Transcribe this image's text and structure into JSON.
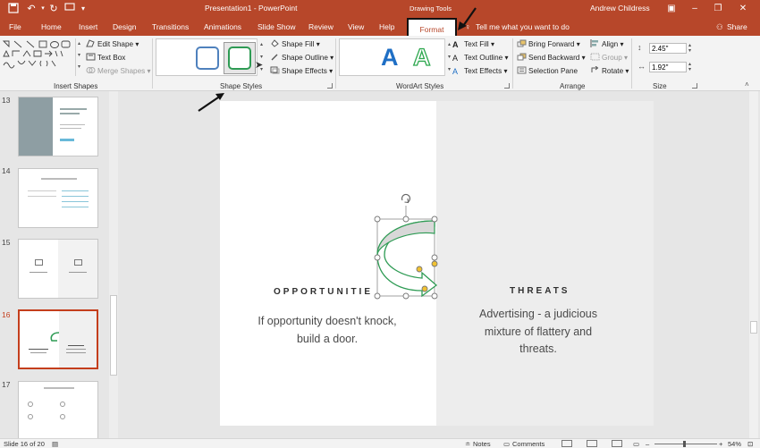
{
  "window": {
    "title": "Presentation1 - PowerPoint",
    "contextual_group": "Drawing Tools",
    "user": "Andrew Childress",
    "share_label": "Share"
  },
  "tabs": [
    "File",
    "Home",
    "Insert",
    "Design",
    "Transitions",
    "Animations",
    "Slide Show",
    "Review",
    "View",
    "Help"
  ],
  "active_tab": "Format",
  "tell_me": "Tell me what you want to do",
  "ribbon": {
    "insert_shapes": {
      "label": "Insert Shapes",
      "edit_shape": "Edit Shape",
      "text_box": "Text Box",
      "merge_shapes": "Merge Shapes"
    },
    "shape_styles": {
      "label": "Shape Styles",
      "fill": "Shape Fill",
      "outline": "Shape Outline",
      "effects": "Shape Effects"
    },
    "wordart_styles": {
      "label": "WordArt Styles",
      "preview_letter_a": "A",
      "preview_letter_b": "A",
      "text_fill": "Text Fill",
      "text_outline": "Text Outline",
      "text_effects": "Text Effects"
    },
    "arrange": {
      "label": "Arrange",
      "bring_forward": "Bring Forward",
      "send_backward": "Send Backward",
      "selection_pane": "Selection Pane",
      "align": "Align",
      "group": "Group",
      "rotate": "Rotate"
    },
    "size": {
      "label": "Size",
      "height": "2.45\"",
      "width": "1.92\""
    }
  },
  "thumbnails": [
    {
      "num": "13",
      "active": false
    },
    {
      "num": "14",
      "active": false
    },
    {
      "num": "15",
      "active": false
    },
    {
      "num": "16",
      "active": true
    },
    {
      "num": "17",
      "active": false
    }
  ],
  "slide": {
    "left_heading": "OPPORTUNITIE",
    "left_body": "If opportunity doesn't knock, build a door.",
    "right_heading": "THREATS",
    "right_body": "Advertising - a judicious mixture of flattery and threats."
  },
  "status": {
    "slide_info": "Slide 16 of 20",
    "notes": "Notes",
    "comments": "Comments",
    "zoom": "54%"
  },
  "colors": {
    "accent": "#b7472a",
    "shape_outline": "#2e9b54",
    "shape_fill": "#d8d8d8",
    "wordart_blue": "#1f6fc5",
    "wordart_green": "#2ea84f"
  }
}
